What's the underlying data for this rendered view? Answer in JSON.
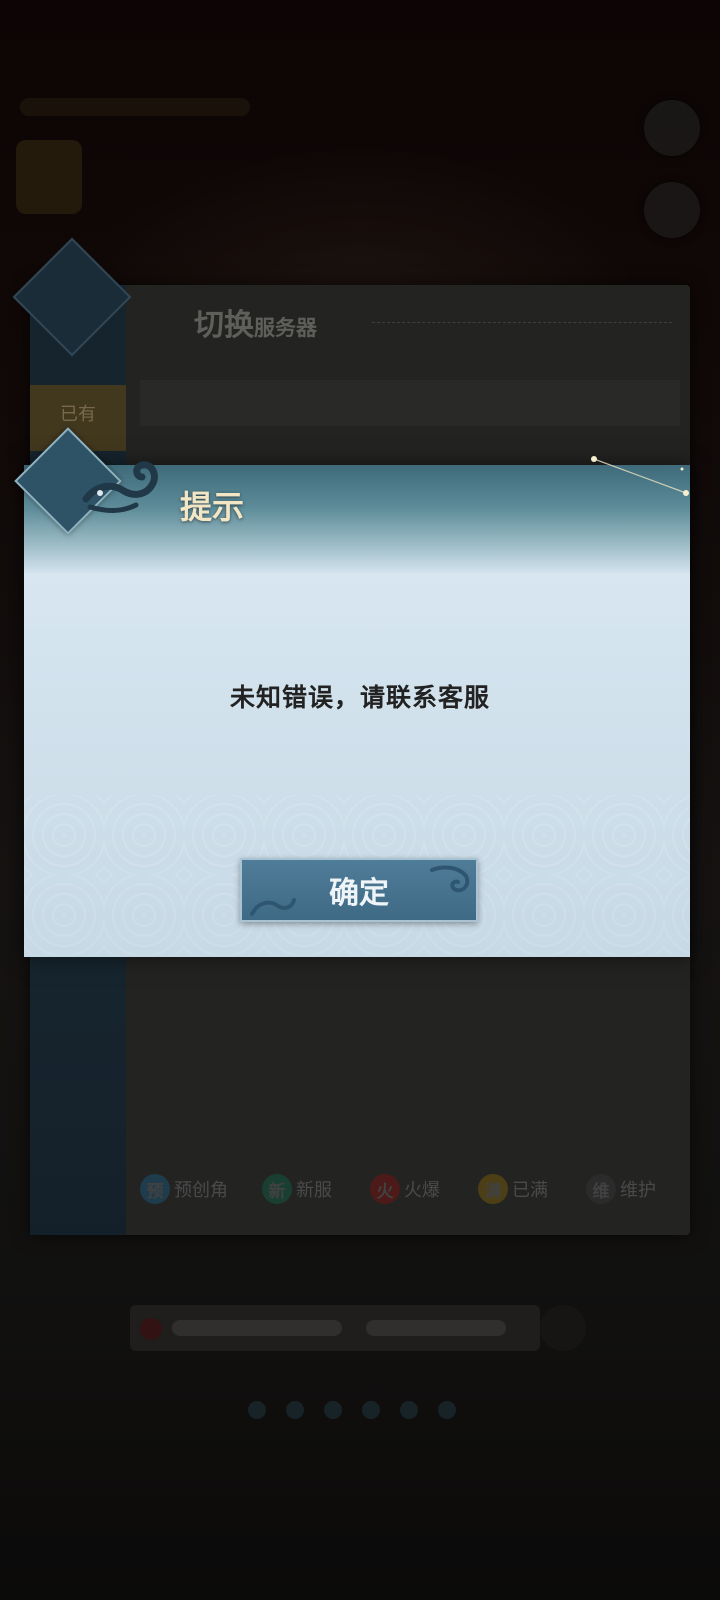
{
  "server_panel": {
    "title_big": "切换",
    "title_small": "服务器",
    "sidebar_tab": "已有"
  },
  "legend": [
    {
      "badge": "预",
      "label": "预创角",
      "color": "#24475a"
    },
    {
      "badge": "新",
      "label": "新服",
      "color": "#1e4a3d"
    },
    {
      "badge": "火",
      "label": "火爆",
      "color": "#5a1f1d"
    },
    {
      "badge": "满",
      "label": "已满",
      "color": "#5a4a1a"
    },
    {
      "badge": "维",
      "label": "维护",
      "color": "#333333"
    }
  ],
  "dialog": {
    "title": "提示",
    "message": "未知错误，请联系客服",
    "confirm_label": "确定"
  },
  "colors": {
    "dialog_title": "#f2e6c4",
    "button_blue": "#4f7c98",
    "header_teal": "#3e6a7a"
  }
}
